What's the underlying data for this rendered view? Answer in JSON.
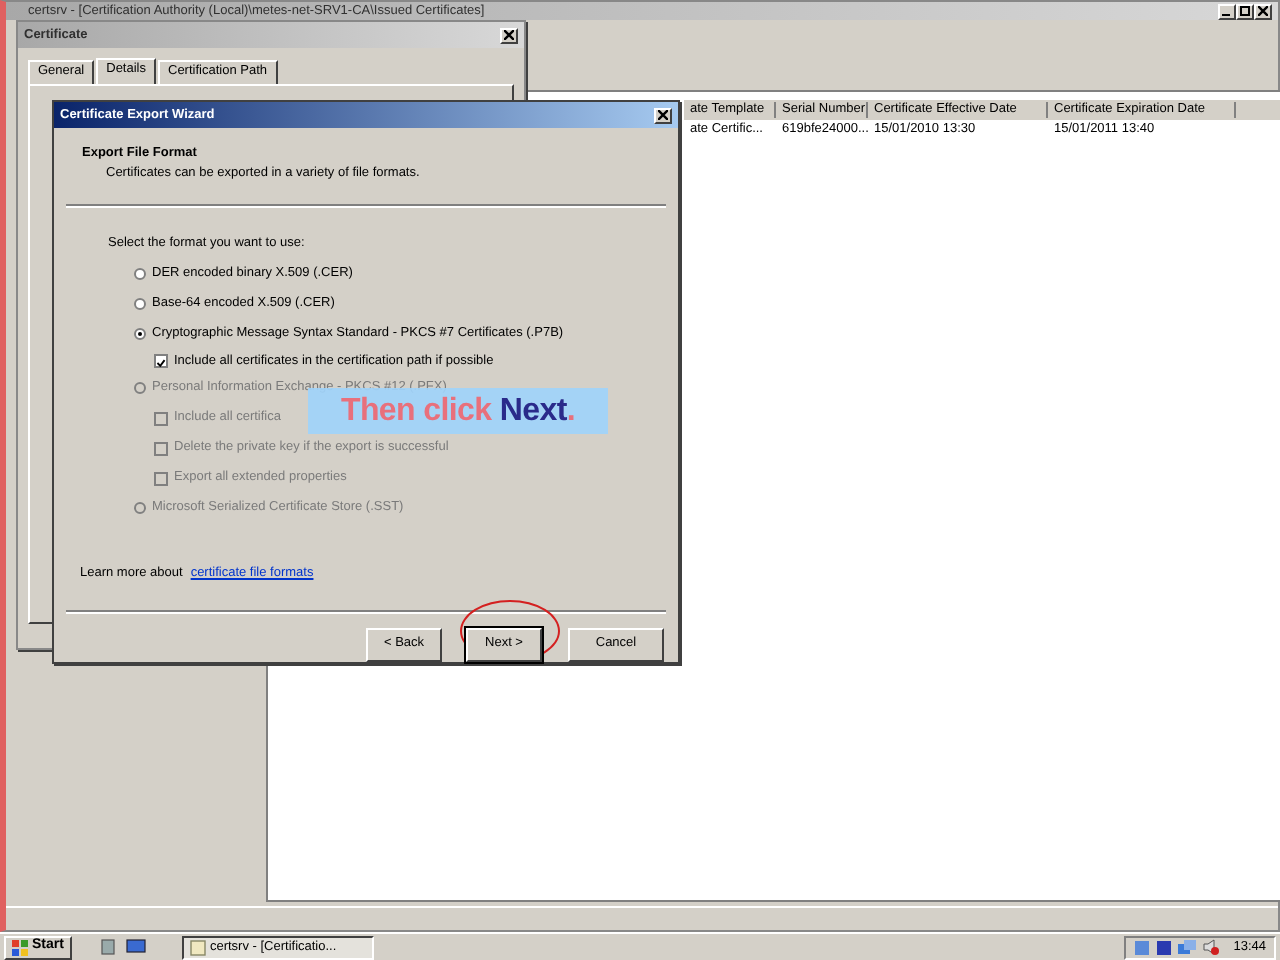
{
  "main_window": {
    "title": "certsrv - [Certification Authority (Local)\\metes-net-SRV1-CA\\Issued Certificates]",
    "list": {
      "columns": [
        "ate Template",
        "Serial Number",
        "Certificate Effective Date",
        "Certificate Expiration Date"
      ],
      "rows": [
        [
          "ate Certific...",
          "619bfe24000...",
          "15/01/2010 13:30",
          "15/01/2011 13:40"
        ]
      ]
    }
  },
  "certificate_dialog": {
    "title": "Certificate",
    "tabs": [
      {
        "label": "General",
        "selected": false
      },
      {
        "label": "Details",
        "selected": true
      },
      {
        "label": "Certification Path",
        "selected": false
      }
    ]
  },
  "export_wizard": {
    "title": "Certificate Export Wizard",
    "heading": "Export File Format",
    "subheading": "Certificates can be exported in a variety of file formats.",
    "prompt": "Select the format you want to use:",
    "options": [
      {
        "label": "DER encoded binary X.509 (.CER)",
        "selected": false,
        "disabled": false
      },
      {
        "label": "Base-64 encoded X.509 (.CER)",
        "selected": false,
        "disabled": false
      },
      {
        "label": "Cryptographic Message Syntax Standard - PKCS #7 Certificates (.P7B)",
        "selected": true,
        "disabled": false,
        "children": [
          {
            "label": "Include all certificates in the certification path if possible",
            "checked": true,
            "disabled": false
          }
        ]
      },
      {
        "label": "Personal Information Exchange - PKCS #12 (.PFX)",
        "selected": false,
        "disabled": true,
        "children": [
          {
            "label": "Include all certifica",
            "checked": false,
            "disabled": true
          },
          {
            "label": "Delete the private key if the export is successful",
            "checked": false,
            "disabled": true
          },
          {
            "label": "Export all extended properties",
            "checked": false,
            "disabled": true
          }
        ]
      },
      {
        "label": "Microsoft Serialized Certificate Store (.SST)",
        "selected": false,
        "disabled": true
      }
    ],
    "help_text": "Learn more about",
    "help_link": "certificate file formats",
    "buttons": [
      {
        "label": "< Back",
        "annotated": false
      },
      {
        "label": "Next >",
        "annotated": true
      },
      {
        "label": "Cancel",
        "annotated": false
      }
    ]
  },
  "callout": {
    "text": "Then click **Next**."
  },
  "taskbar": {
    "start": "Start",
    "tasks": [
      {
        "label": "certsrv - [Certificatio...",
        "selected": true
      }
    ],
    "clock": "13:44"
  }
}
